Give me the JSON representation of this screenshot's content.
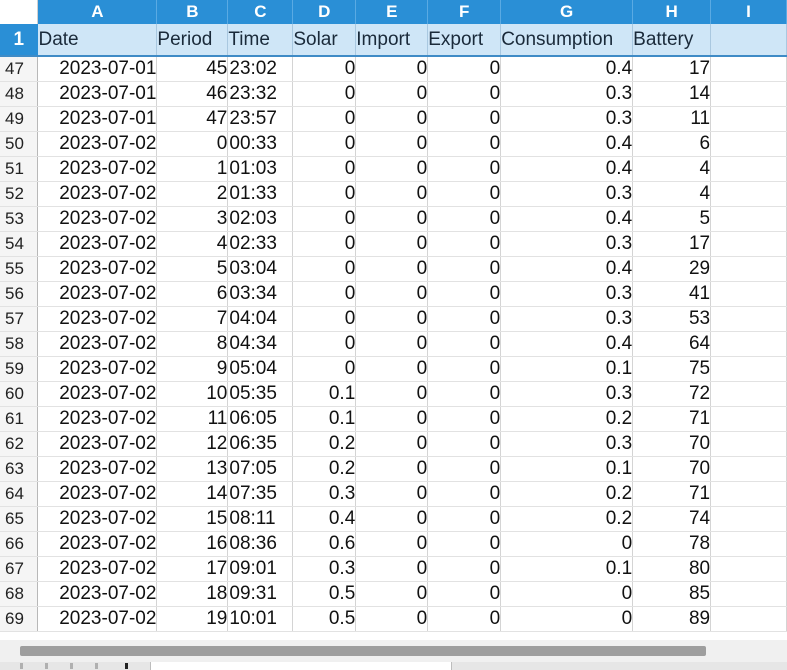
{
  "columns": [
    "A",
    "B",
    "C",
    "D",
    "E",
    "F",
    "G",
    "H",
    "I"
  ],
  "header": {
    "row_number": "1",
    "cells": [
      "Date",
      "Period",
      "Time",
      "Solar",
      "Import",
      "Export",
      "Consumption",
      "Battery",
      ""
    ]
  },
  "rows": [
    {
      "n": "47",
      "date": "2023-07-01",
      "period": "45",
      "time": "23:02",
      "solar": "0",
      "import": "0",
      "export": "0",
      "consumption": "0.4",
      "battery": "17"
    },
    {
      "n": "48",
      "date": "2023-07-01",
      "period": "46",
      "time": "23:32",
      "solar": "0",
      "import": "0",
      "export": "0",
      "consumption": "0.3",
      "battery": "14"
    },
    {
      "n": "49",
      "date": "2023-07-01",
      "period": "47",
      "time": "23:57",
      "solar": "0",
      "import": "0",
      "export": "0",
      "consumption": "0.3",
      "battery": "11"
    },
    {
      "n": "50",
      "date": "2023-07-02",
      "period": "0",
      "time": "00:33",
      "solar": "0",
      "import": "0",
      "export": "0",
      "consumption": "0.4",
      "battery": "6"
    },
    {
      "n": "51",
      "date": "2023-07-02",
      "period": "1",
      "time": "01:03",
      "solar": "0",
      "import": "0",
      "export": "0",
      "consumption": "0.4",
      "battery": "4"
    },
    {
      "n": "52",
      "date": "2023-07-02",
      "period": "2",
      "time": "01:33",
      "solar": "0",
      "import": "0",
      "export": "0",
      "consumption": "0.3",
      "battery": "4"
    },
    {
      "n": "53",
      "date": "2023-07-02",
      "period": "3",
      "time": "02:03",
      "solar": "0",
      "import": "0",
      "export": "0",
      "consumption": "0.4",
      "battery": "5"
    },
    {
      "n": "54",
      "date": "2023-07-02",
      "period": "4",
      "time": "02:33",
      "solar": "0",
      "import": "0",
      "export": "0",
      "consumption": "0.3",
      "battery": "17"
    },
    {
      "n": "55",
      "date": "2023-07-02",
      "period": "5",
      "time": "03:04",
      "solar": "0",
      "import": "0",
      "export": "0",
      "consumption": "0.4",
      "battery": "29"
    },
    {
      "n": "56",
      "date": "2023-07-02",
      "period": "6",
      "time": "03:34",
      "solar": "0",
      "import": "0",
      "export": "0",
      "consumption": "0.3",
      "battery": "41"
    },
    {
      "n": "57",
      "date": "2023-07-02",
      "period": "7",
      "time": "04:04",
      "solar": "0",
      "import": "0",
      "export": "0",
      "consumption": "0.3",
      "battery": "53"
    },
    {
      "n": "58",
      "date": "2023-07-02",
      "period": "8",
      "time": "04:34",
      "solar": "0",
      "import": "0",
      "export": "0",
      "consumption": "0.4",
      "battery": "64"
    },
    {
      "n": "59",
      "date": "2023-07-02",
      "period": "9",
      "time": "05:04",
      "solar": "0",
      "import": "0",
      "export": "0",
      "consumption": "0.1",
      "battery": "75"
    },
    {
      "n": "60",
      "date": "2023-07-02",
      "period": "10",
      "time": "05:35",
      "solar": "0.1",
      "import": "0",
      "export": "0",
      "consumption": "0.3",
      "battery": "72"
    },
    {
      "n": "61",
      "date": "2023-07-02",
      "period": "11",
      "time": "06:05",
      "solar": "0.1",
      "import": "0",
      "export": "0",
      "consumption": "0.2",
      "battery": "71"
    },
    {
      "n": "62",
      "date": "2023-07-02",
      "period": "12",
      "time": "06:35",
      "solar": "0.2",
      "import": "0",
      "export": "0",
      "consumption": "0.3",
      "battery": "70"
    },
    {
      "n": "63",
      "date": "2023-07-02",
      "period": "13",
      "time": "07:05",
      "solar": "0.2",
      "import": "0",
      "export": "0",
      "consumption": "0.1",
      "battery": "70"
    },
    {
      "n": "64",
      "date": "2023-07-02",
      "period": "14",
      "time": "07:35",
      "solar": "0.3",
      "import": "0",
      "export": "0",
      "consumption": "0.2",
      "battery": "71"
    },
    {
      "n": "65",
      "date": "2023-07-02",
      "period": "15",
      "time": "08:11",
      "solar": "0.4",
      "import": "0",
      "export": "0",
      "consumption": "0.2",
      "battery": "74"
    },
    {
      "n": "66",
      "date": "2023-07-02",
      "period": "16",
      "time": "08:36",
      "solar": "0.6",
      "import": "0",
      "export": "0",
      "consumption": "0",
      "battery": "78"
    },
    {
      "n": "67",
      "date": "2023-07-02",
      "period": "17",
      "time": "09:01",
      "solar": "0.3",
      "import": "0",
      "export": "0",
      "consumption": "0.1",
      "battery": "80"
    },
    {
      "n": "68",
      "date": "2023-07-02",
      "period": "18",
      "time": "09:31",
      "solar": "0.5",
      "import": "0",
      "export": "0",
      "consumption": "0",
      "battery": "85"
    },
    {
      "n": "69",
      "date": "2023-07-02",
      "period": "19",
      "time": "10:01",
      "solar": "0.5",
      "import": "0",
      "export": "0",
      "consumption": "0",
      "battery": "89"
    }
  ],
  "colors": {
    "column_header_bg": "#2a8fd6",
    "header_row_bg": "#cfe6f7",
    "grid_line": "#d4d4d4"
  }
}
